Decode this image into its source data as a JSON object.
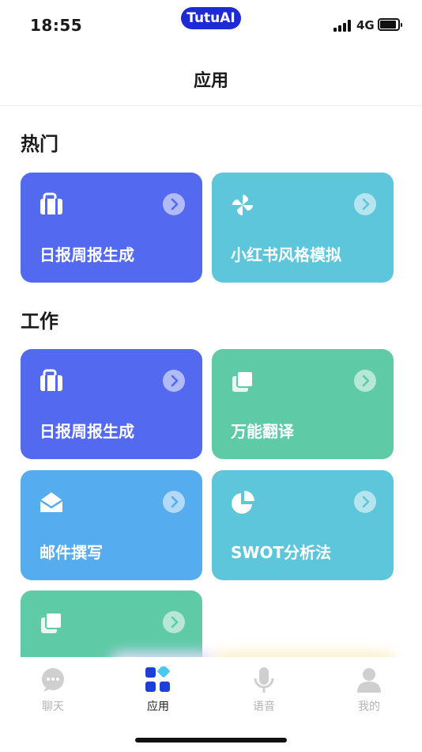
{
  "status_bar": {
    "time": "18:55",
    "app_badge": "TutuAI",
    "network": "4G"
  },
  "header": {
    "title": "应用"
  },
  "sections": [
    {
      "title": "热门",
      "cards": [
        {
          "label": "日报周报生成",
          "icon": "briefcase-icon",
          "color": "#5269f0"
        },
        {
          "label": "小红书风格模拟",
          "icon": "pinwheel-icon",
          "color": "#5ec6db"
        }
      ]
    },
    {
      "title": "工作",
      "cards": [
        {
          "label": "日报周报生成",
          "icon": "briefcase-icon",
          "color": "#5269f0"
        },
        {
          "label": "万能翻译",
          "icon": "copy-icon",
          "color": "#5ecaa6"
        },
        {
          "label": "邮件撰写",
          "icon": "mail-icon",
          "color": "#55acef"
        },
        {
          "label": "SWOT分析法",
          "icon": "pie-chart-icon",
          "color": "#5ec6db"
        },
        {
          "label": "",
          "icon": "copy-icon",
          "color": "#5ecaa6"
        }
      ]
    }
  ],
  "tabbar": {
    "tabs": [
      {
        "label": "聊天",
        "icon": "chat-icon",
        "active": false
      },
      {
        "label": "应用",
        "icon": "apps-icon",
        "active": true
      },
      {
        "label": "语音",
        "icon": "microphone-icon",
        "active": false
      },
      {
        "label": "我的",
        "icon": "profile-icon",
        "active": false
      }
    ]
  }
}
